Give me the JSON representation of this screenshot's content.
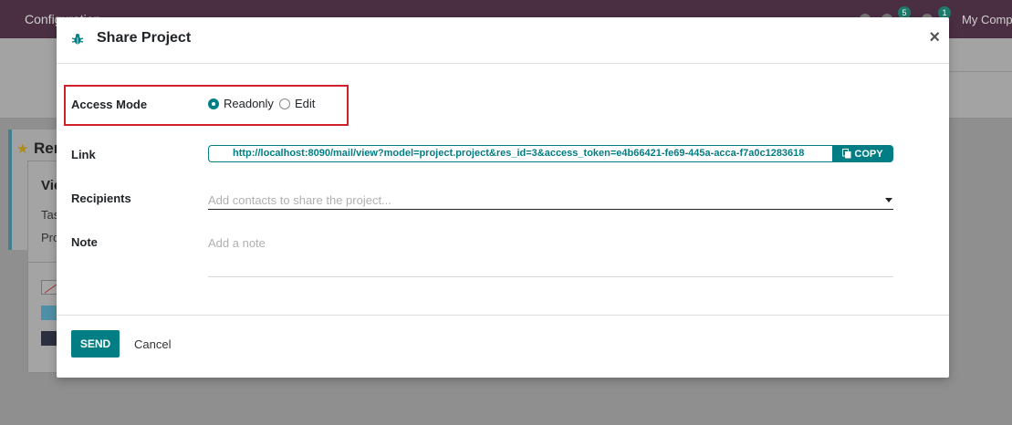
{
  "background": {
    "nav_menu": "Configuration",
    "company": "My Company",
    "badges": [
      "5",
      "1"
    ],
    "card_title": "Rem",
    "popup_title": "Vie",
    "popup_lines": [
      "Tas",
      "Pro"
    ]
  },
  "dialog": {
    "title": "Share Project",
    "close_symbol": "×",
    "fields": {
      "access_mode_label": "Access Mode",
      "link_label": "Link",
      "recipients_label": "Recipients",
      "note_label": "Note"
    },
    "access_mode": {
      "options": [
        "Readonly",
        "Edit"
      ],
      "selected": "Readonly"
    },
    "link_url": "http://localhost:8090/mail/view?model=project.project&res_id=3&access_token=e4b66421-fe69-445a-acca-f7a0c1283618",
    "copy_label": "COPY",
    "recipients_placeholder": "Add contacts to share the project...",
    "note_placeholder": "Add a note",
    "send_label": "SEND",
    "cancel_label": "Cancel"
  },
  "colors": {
    "primary": "#017e84",
    "highlight": "#d0212b",
    "navbar": "#4a2f42"
  }
}
